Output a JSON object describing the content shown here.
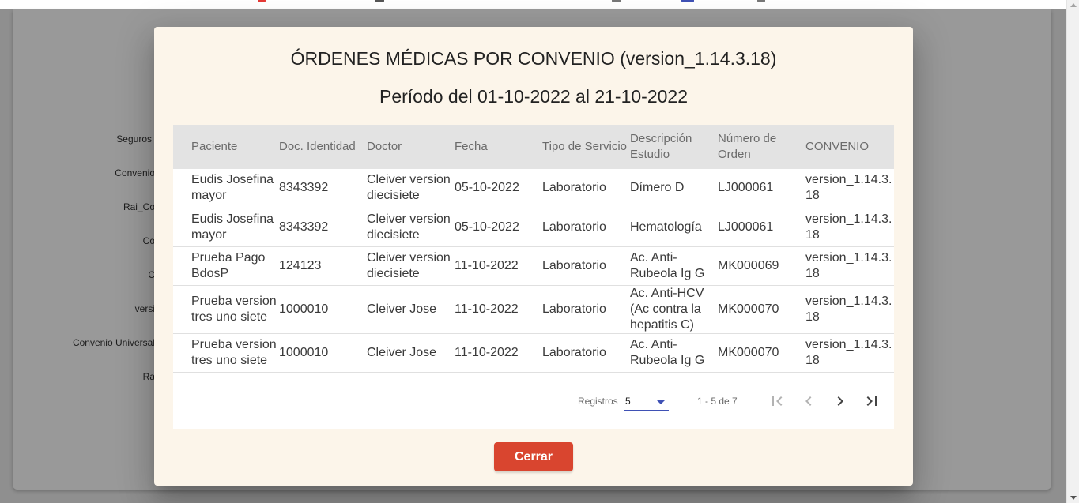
{
  "modal": {
    "title": "ÓRDENES MÉDICAS POR CONVENIO (version_1.14.3.18)",
    "subtitle": "Período del 01-10-2022 al 21-10-2022",
    "close_label": "Cerrar"
  },
  "table": {
    "headers": {
      "paciente": "Paciente",
      "doc": "Doc. Identidad",
      "doctor": "Doctor",
      "fecha": "Fecha",
      "tipo": "Tipo de Servicio",
      "descripcion": "Descripción Estudio",
      "orden": "Número de Orden",
      "convenio": "CONVENIO"
    },
    "rows": [
      {
        "paciente": "Eudis Josefina mayor",
        "doc": "8343392",
        "doctor": "Cleiver version diecisiete",
        "fecha": "05-10-2022",
        "tipo": "Laboratorio",
        "descripcion": "Dímero D",
        "orden": "LJ000061",
        "convenio": "version_1.14.3.18"
      },
      {
        "paciente": "Eudis Josefina mayor",
        "doc": "8343392",
        "doctor": "Cleiver version diecisiete",
        "fecha": "05-10-2022",
        "tipo": "Laboratorio",
        "descripcion": "Hematología",
        "orden": "LJ000061",
        "convenio": "version_1.14.3.18"
      },
      {
        "paciente": "Prueba Pago BdosP",
        "doc": "124123",
        "doctor": "Cleiver version diecisiete",
        "fecha": "11-10-2022",
        "tipo": "Laboratorio",
        "descripcion": "Ac. Anti-Rubeola Ig G",
        "orden": "MK000069",
        "convenio": "version_1.14.3.18"
      },
      {
        "paciente": "Prueba version tres uno siete",
        "doc": "1000010",
        "doctor": "Cleiver Jose",
        "fecha": "11-10-2022",
        "tipo": "Laboratorio",
        "descripcion": "Ac. Anti-HCV (Ac contra la hepatitis C)",
        "orden": "MK000070",
        "convenio": "version_1.14.3.18"
      },
      {
        "paciente": "Prueba version tres uno siete",
        "doc": "1000010",
        "doctor": "Cleiver Jose",
        "fecha": "11-10-2022",
        "tipo": "Laboratorio",
        "descripcion": "Ac. Anti-Rubeola Ig G",
        "orden": "MK000070",
        "convenio": "version_1.14.3.18"
      }
    ]
  },
  "paginator": {
    "label": "Registros",
    "page_size": "5",
    "range": "1 - 5 de 7",
    "first_icon": "first-page-icon",
    "prev_icon": "chevron-left-icon",
    "next_icon": "chevron-right-icon",
    "last_icon": "last-page-icon"
  },
  "background": {
    "labels": [
      "Seguros",
      "Convenio",
      "Rai_Co",
      "Co",
      "C",
      "versi",
      "Convenio Universal",
      "Ra"
    ]
  },
  "colors": {
    "modal_bg": "#fcf5ea",
    "header_bg": "#e3e3e3",
    "close_button": "#d9452f",
    "select_accent": "#3f51b5"
  }
}
